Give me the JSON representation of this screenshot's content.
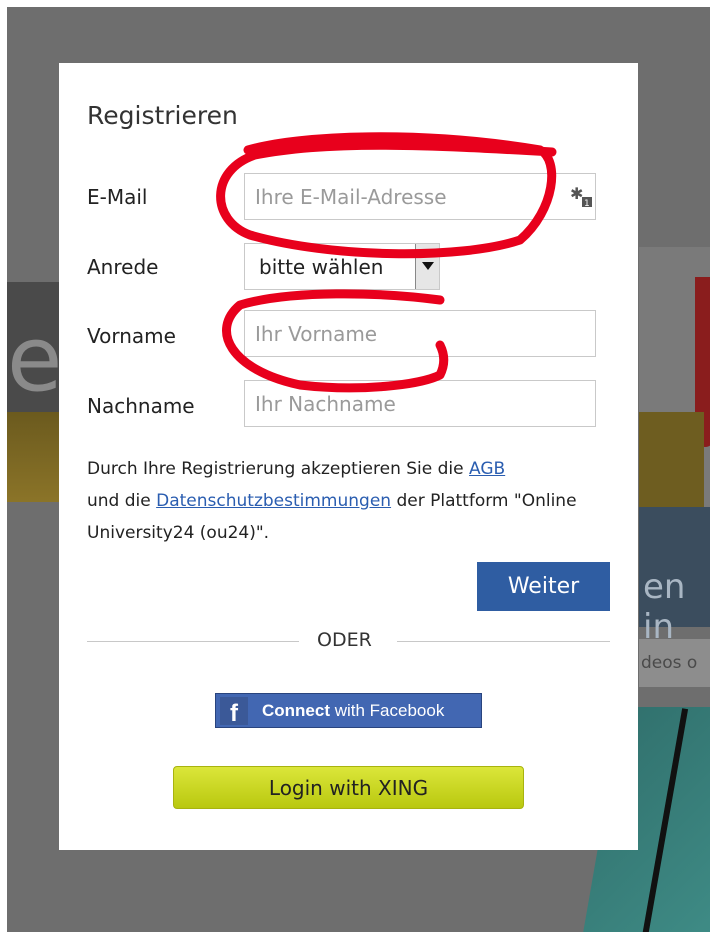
{
  "background": {
    "partial_heading": "en in",
    "partial_search": "deos o"
  },
  "modal": {
    "title": "Registrieren",
    "fields": {
      "email": {
        "label": "E-Mail",
        "placeholder": "Ihre E-Mail-Adresse",
        "value": ""
      },
      "salutation": {
        "label": "Anrede",
        "selected": "bitte wählen"
      },
      "firstname": {
        "label": "Vorname",
        "placeholder": "Ihr Vorname",
        "value": ""
      },
      "lastname": {
        "label": "Nachname",
        "placeholder": "Ihr Nachname",
        "value": ""
      }
    },
    "terms": {
      "part1": "Durch Ihre Registrierung akzeptieren Sie die ",
      "agb_link": "AGB",
      "part2": " und die ",
      "privacy_link": "Datenschutzbestimmungen",
      "part3": " der Plattform \"Online University24 (ou24)\"."
    },
    "submit_label": "Weiter",
    "divider_label": "ODER",
    "facebook": {
      "bold": "Connect",
      "rest": " with Facebook"
    },
    "xing_label": "Login with XING"
  },
  "colors": {
    "accent": "#2f5da2",
    "facebook": "#4267b2",
    "xing": "#c7d423",
    "annotation": "#e8001c"
  }
}
